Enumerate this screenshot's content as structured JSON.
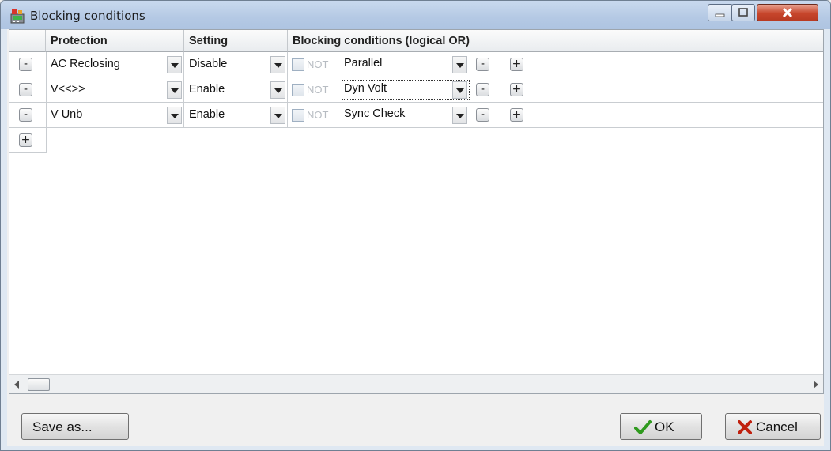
{
  "window": {
    "title": "Blocking conditions"
  },
  "table": {
    "columns": {
      "protection": "Protection",
      "setting": "Setting",
      "blocking": "Blocking conditions (logical OR)"
    },
    "rows": [
      {
        "protection": "AC Reclosing",
        "setting": "Disable",
        "not_label": "NOT",
        "not_checked": false,
        "condition": "Parallel"
      },
      {
        "protection": "V<<>>",
        "setting": "Enable",
        "not_label": "NOT",
        "not_checked": false,
        "condition": "Dyn Volt"
      },
      {
        "protection": "V Unb",
        "setting": "Enable",
        "not_label": "NOT",
        "not_checked": false,
        "condition": "Sync Check"
      }
    ],
    "remove_row_symbol": "-",
    "add_row_symbol": "+",
    "remove_condition_symbol": "-",
    "add_condition_symbol": "+"
  },
  "footer": {
    "save_as_label": "Save as...",
    "ok_label": "OK",
    "cancel_label": "Cancel"
  },
  "colors": {
    "ok_check": "#2f9a1e",
    "cancel_x": "#c0200e",
    "close_button": "#c7462c"
  }
}
